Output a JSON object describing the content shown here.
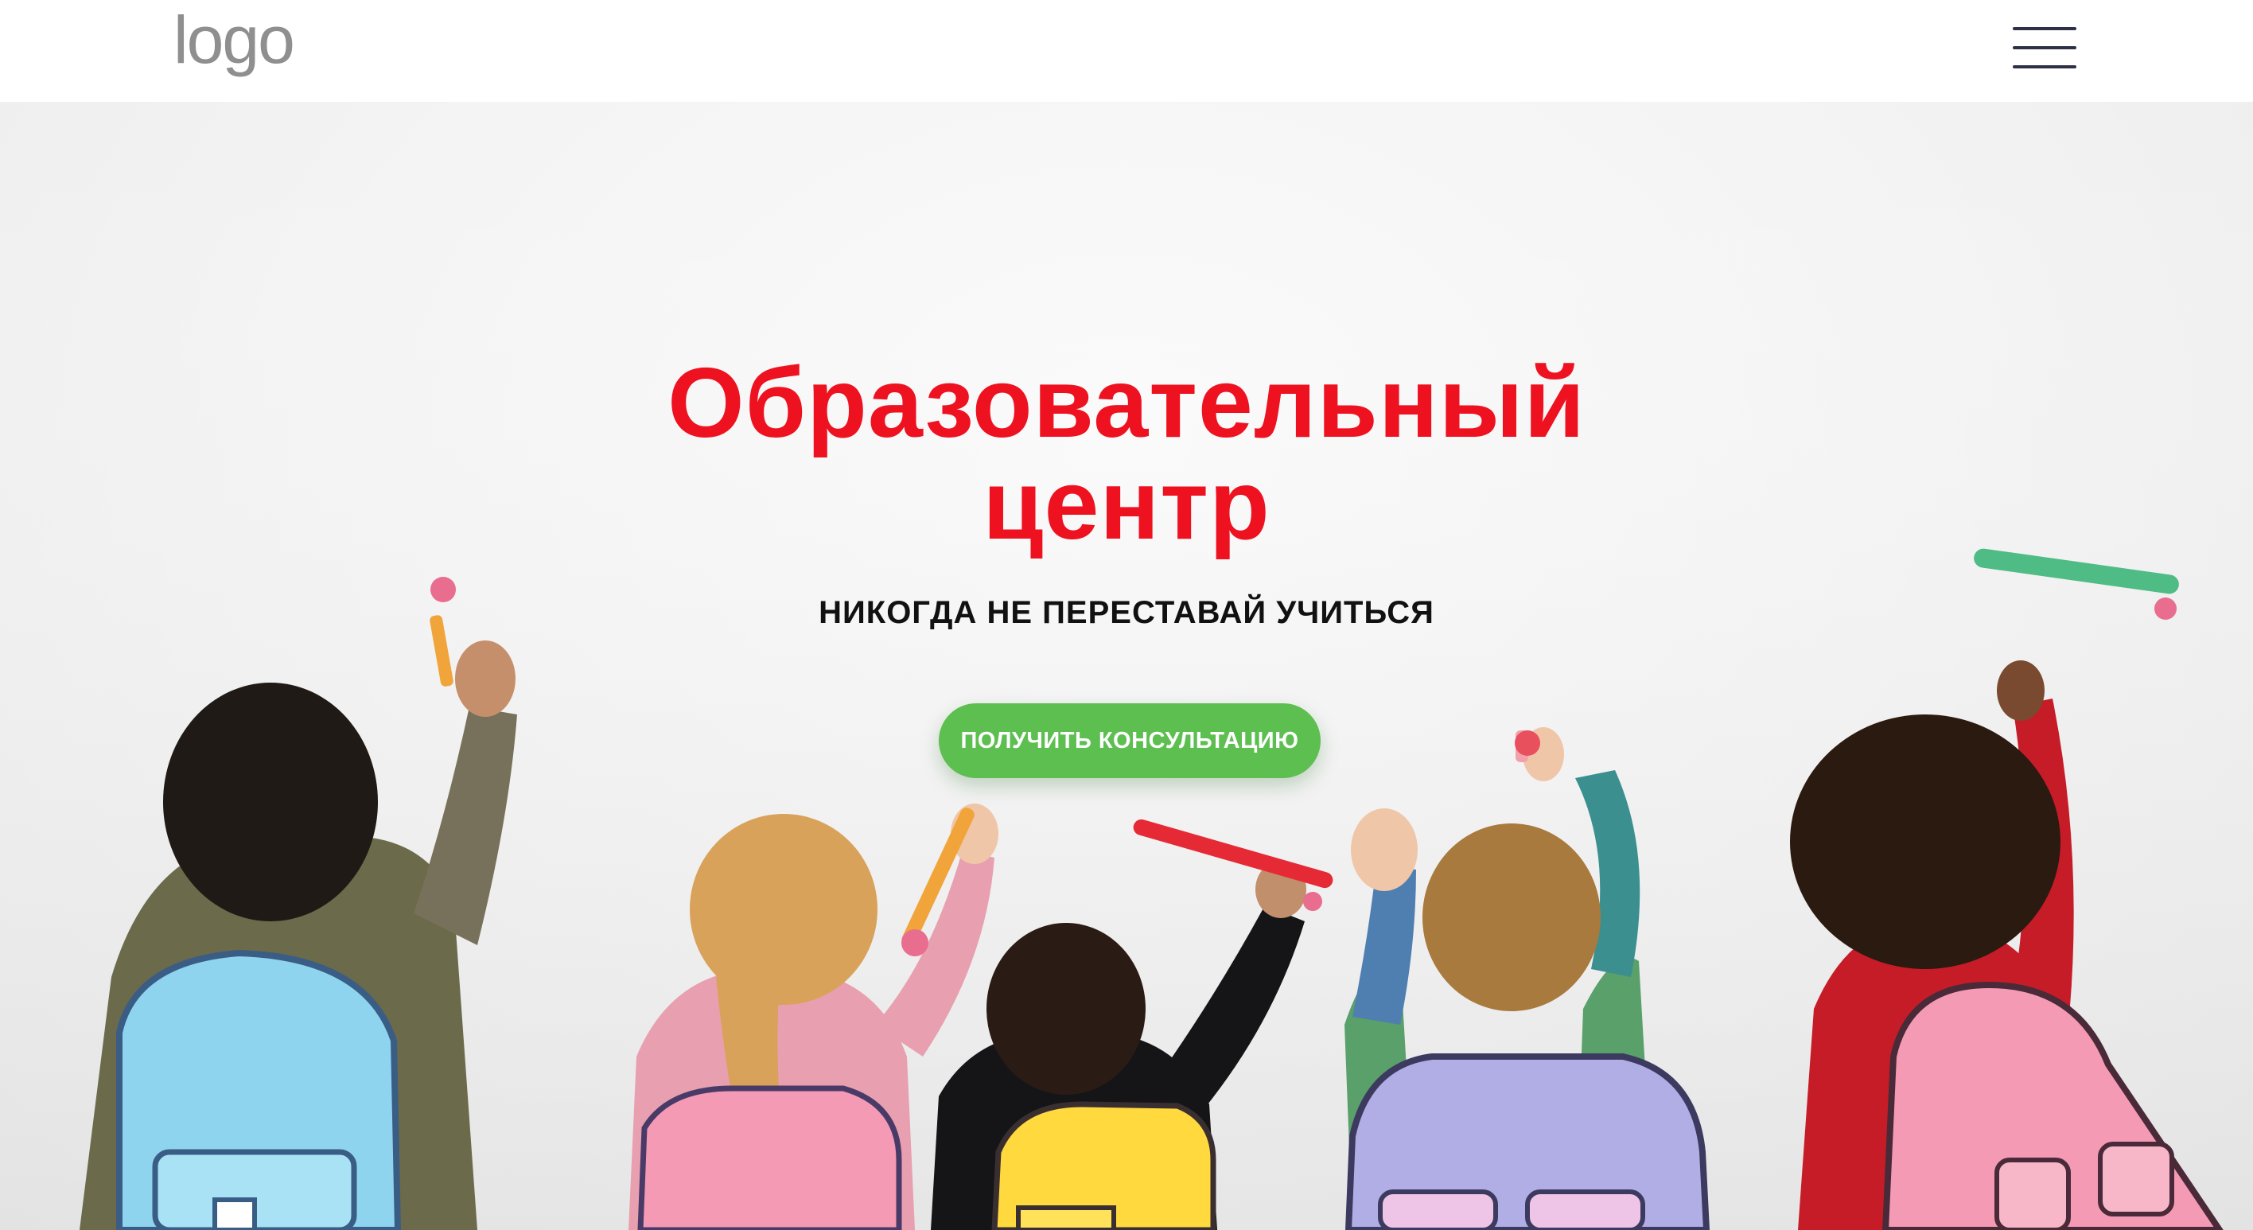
{
  "header": {
    "logo_text": "logo",
    "menu_icon": "hamburger-menu-icon"
  },
  "hero": {
    "title_line1": "Образовательный",
    "title_line2": "центр",
    "subtitle": "НИКОГДА НЕ ПЕРЕСТАВАЙ УЧИТЬСЯ",
    "cta_label": "ПОЛУЧИТЬ КОНСУЛЬТАЦИЮ",
    "background_image": "children-with-backpacks-drawing-on-wall"
  },
  "colors": {
    "title": "#ee1221",
    "cta": "#5cbf4f",
    "menu_icon": "#2d3147",
    "logo": "#8f8f8f"
  }
}
